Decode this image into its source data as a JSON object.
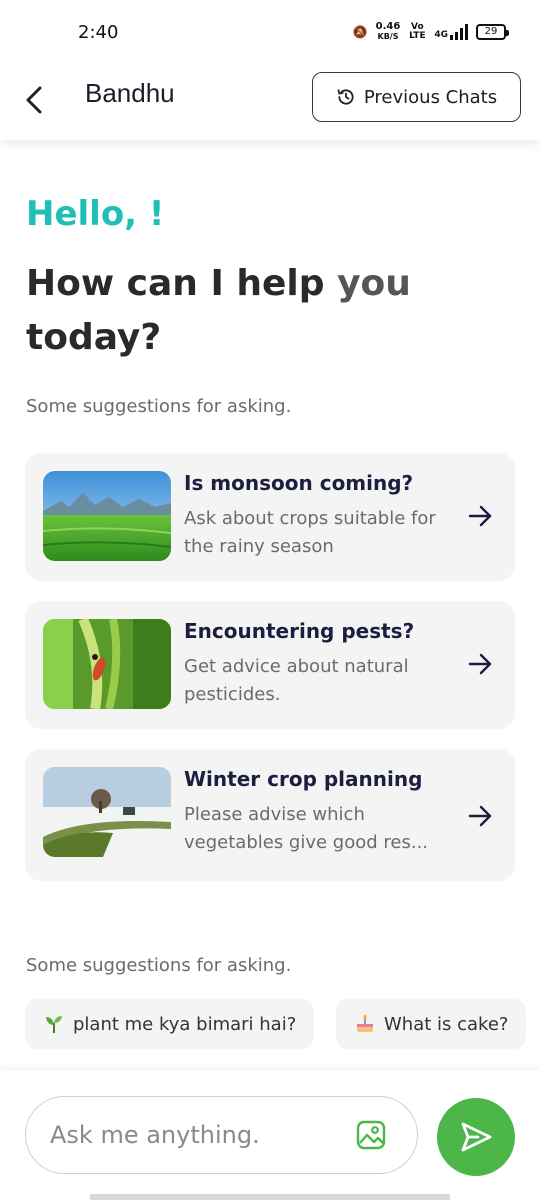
{
  "status_bar": {
    "time": "2:40",
    "speed_value": "0.46",
    "speed_unit": "KB/S",
    "network_label": "Vo LTE",
    "network_type": "4G",
    "battery": "29"
  },
  "header": {
    "title": "Bandhu",
    "previous_chats_label": "Previous Chats"
  },
  "greeting": {
    "hello": "Hello, !",
    "help_line": "How can I help",
    "help_you": "you",
    "help_today": "today?"
  },
  "suggestions_label": "Some suggestions for asking.",
  "cards": [
    {
      "title": "Is monsoon coming?",
      "description": "Ask about crops suitable for the rainy season"
    },
    {
      "title": "Encountering pests?",
      "description": "Get advice about natural pesticides."
    },
    {
      "title": "Winter crop planning",
      "description": "Please advise which vegetables give good res..."
    }
  ],
  "suggestions_label_2": "Some suggestions for asking.",
  "chips": [
    {
      "label": "plant me kya bimari hai?",
      "icon": "seedling-icon"
    },
    {
      "label": "What is cake?",
      "icon": "cake-icon"
    }
  ],
  "input": {
    "placeholder": "Ask me anything."
  },
  "colors": {
    "accent_teal": "#1fbfb8",
    "send_green": "#4cb648",
    "card_bg": "#f4f4f5"
  }
}
